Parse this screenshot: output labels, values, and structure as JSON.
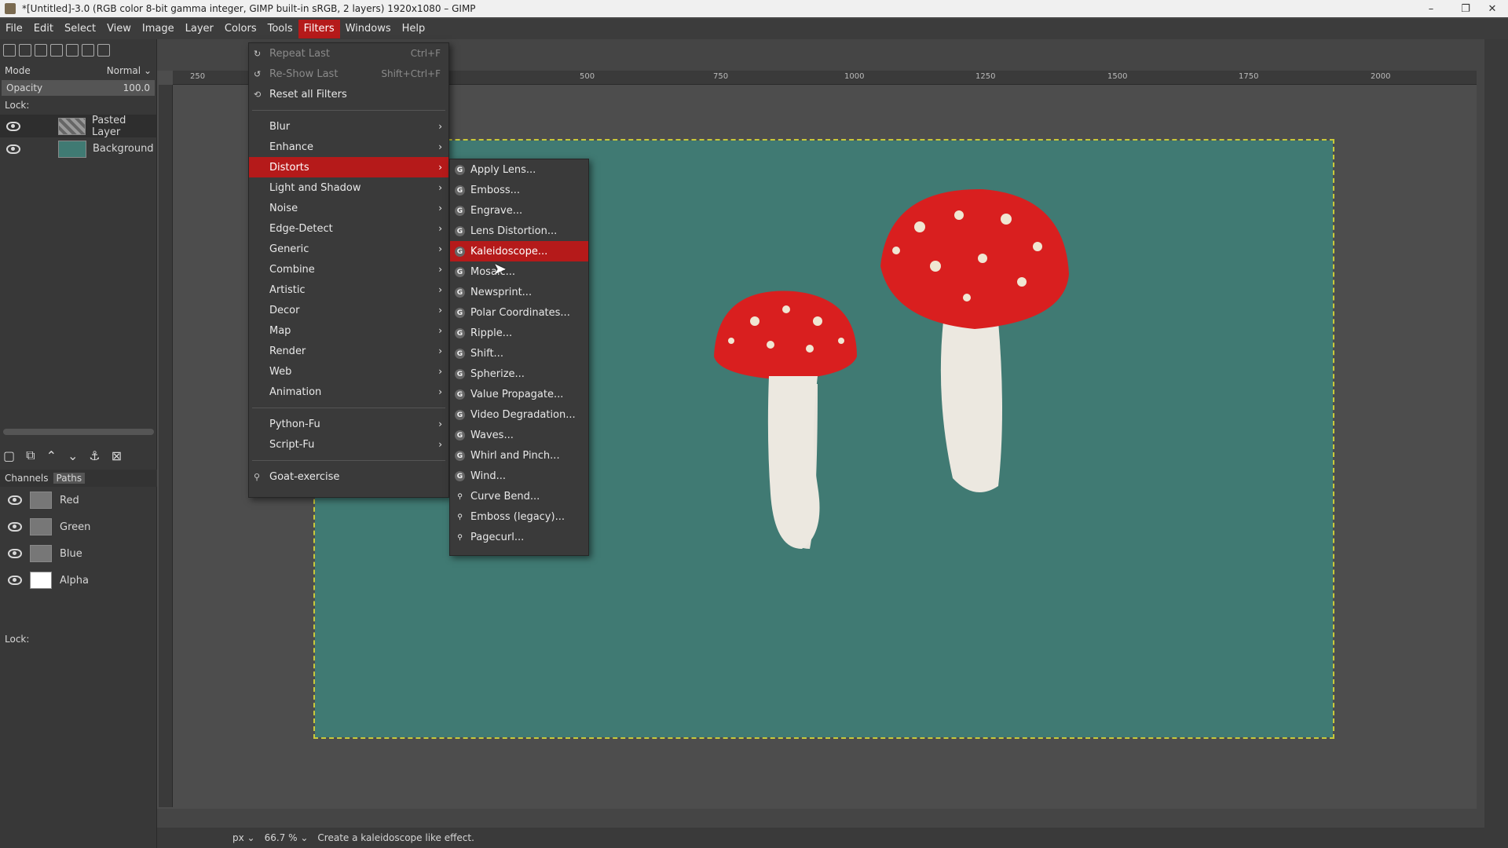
{
  "window": {
    "title": "*[Untitled]-3.0 (RGB color 8-bit gamma integer, GIMP built-in sRGB, 2 layers) 1920x1080 – GIMP"
  },
  "menubar": [
    "File",
    "Edit",
    "Select",
    "View",
    "Image",
    "Layer",
    "Colors",
    "Tools",
    "Filters",
    "Windows",
    "Help"
  ],
  "layers_panel": {
    "mode_label": "Mode",
    "mode_value": "Normal",
    "opacity_label": "Opacity",
    "opacity_value": "100.0",
    "lock_label": "Lock:",
    "layers": [
      "Pasted Layer",
      "Background"
    ]
  },
  "channels_panel": {
    "tabs": [
      "Channels",
      "Paths"
    ],
    "channels": [
      "Red",
      "Green",
      "Blue",
      "Alpha"
    ],
    "lock_label": "Lock:"
  },
  "ruler": {
    "ticks": [
      "250",
      "500",
      "750",
      "1000",
      "1250",
      "1500",
      "1750",
      "2000"
    ]
  },
  "filters_menu": {
    "repeat": {
      "label": "Repeat Last",
      "accel": "Ctrl+F"
    },
    "reshow": {
      "label": "Re-Show Last",
      "accel": "Shift+Ctrl+F"
    },
    "reset": "Reset all Filters",
    "groups": [
      "Blur",
      "Enhance",
      "Distorts",
      "Light and Shadow",
      "Noise",
      "Edge-Detect",
      "Generic",
      "Combine",
      "Artistic",
      "Decor",
      "Map",
      "Render",
      "Web",
      "Animation"
    ],
    "scripts": [
      "Python-Fu",
      "Script-Fu"
    ],
    "goat": "Goat-exercise"
  },
  "distorts_menu": {
    "gegl_items": [
      "Apply Lens...",
      "Emboss...",
      "Engrave...",
      "Lens Distortion...",
      "Kaleidoscope...",
      "Mosaic...",
      "Newsprint...",
      "Polar Coordinates...",
      "Ripple...",
      "Shift...",
      "Spherize...",
      "Value Propagate...",
      "Video Degradation...",
      "Waves...",
      "Whirl and Pinch...",
      "Wind..."
    ],
    "legacy_items": [
      "Curve Bend...",
      "Emboss (legacy)...",
      "Pagecurl..."
    ],
    "highlighted": "Kaleidoscope..."
  },
  "statusbar": {
    "unit": "px",
    "zoom": "66.7 %",
    "message": "Create a kaleidoscope like effect."
  },
  "colors": {
    "accent": "#b51a1a",
    "canvas_bg": "#407a73"
  }
}
